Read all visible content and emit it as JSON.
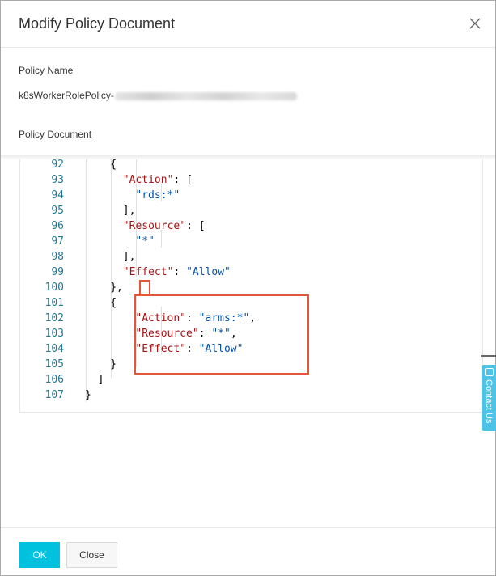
{
  "dialog": {
    "title": "Modify Policy Document",
    "close_icon": "close-icon"
  },
  "policy_name": {
    "label": "Policy Name",
    "value": "k8sWorkerRolePolicy-"
  },
  "policy_document": {
    "label": "Policy Document",
    "lines": [
      {
        "n": "92",
        "indent": 4,
        "tokens": [
          {
            "t": "p",
            "v": "{"
          }
        ]
      },
      {
        "n": "93",
        "indent": 6,
        "tokens": [
          {
            "t": "k",
            "v": "\"Action\""
          },
          {
            "t": "p",
            "v": ": ["
          }
        ]
      },
      {
        "n": "94",
        "indent": 8,
        "tokens": [
          {
            "t": "s",
            "v": "\"rds:*\""
          }
        ]
      },
      {
        "n": "95",
        "indent": 6,
        "tokens": [
          {
            "t": "p",
            "v": "],"
          }
        ]
      },
      {
        "n": "96",
        "indent": 6,
        "tokens": [
          {
            "t": "k",
            "v": "\"Resource\""
          },
          {
            "t": "p",
            "v": ": ["
          }
        ]
      },
      {
        "n": "97",
        "indent": 8,
        "tokens": [
          {
            "t": "s",
            "v": "\"*\""
          }
        ]
      },
      {
        "n": "98",
        "indent": 6,
        "tokens": [
          {
            "t": "p",
            "v": "],"
          }
        ]
      },
      {
        "n": "99",
        "indent": 6,
        "tokens": [
          {
            "t": "k",
            "v": "\"Effect\""
          },
          {
            "t": "p",
            "v": ": "
          },
          {
            "t": "s",
            "v": "\"Allow\""
          }
        ]
      },
      {
        "n": "100",
        "indent": 4,
        "tokens": [
          {
            "t": "p",
            "v": "},"
          }
        ]
      },
      {
        "n": "101",
        "indent": 4,
        "tokens": [
          {
            "t": "p",
            "v": "{"
          }
        ]
      },
      {
        "n": "102",
        "indent": 8,
        "tokens": [
          {
            "t": "k",
            "v": "\"Action\""
          },
          {
            "t": "p",
            "v": ": "
          },
          {
            "t": "s",
            "v": "\"arms:*\""
          },
          {
            "t": "p",
            "v": ","
          }
        ]
      },
      {
        "n": "103",
        "indent": 8,
        "tokens": [
          {
            "t": "k",
            "v": "\"Resource\""
          },
          {
            "t": "p",
            "v": ": "
          },
          {
            "t": "s",
            "v": "\"*\""
          },
          {
            "t": "p",
            "v": ","
          }
        ]
      },
      {
        "n": "104",
        "indent": 8,
        "tokens": [
          {
            "t": "k",
            "v": "\"Effect\""
          },
          {
            "t": "p",
            "v": ": "
          },
          {
            "t": "s",
            "v": "\"Allow\""
          }
        ]
      },
      {
        "n": "105",
        "indent": 4,
        "tokens": [
          {
            "t": "p",
            "v": "}"
          }
        ]
      },
      {
        "n": "106",
        "indent": 2,
        "tokens": [
          {
            "t": "p",
            "v": "]"
          }
        ]
      },
      {
        "n": "107",
        "indent": 0,
        "tokens": [
          {
            "t": "p",
            "v": "}"
          }
        ]
      }
    ]
  },
  "contact": {
    "label": "Contact Us"
  },
  "footer": {
    "ok_label": "OK",
    "close_label": "Close"
  },
  "colors": {
    "primary": "#00c1de",
    "highlight": "#e4553a",
    "json_key": "#a31515",
    "json_string": "#0451a5",
    "line_number": "#237893"
  }
}
